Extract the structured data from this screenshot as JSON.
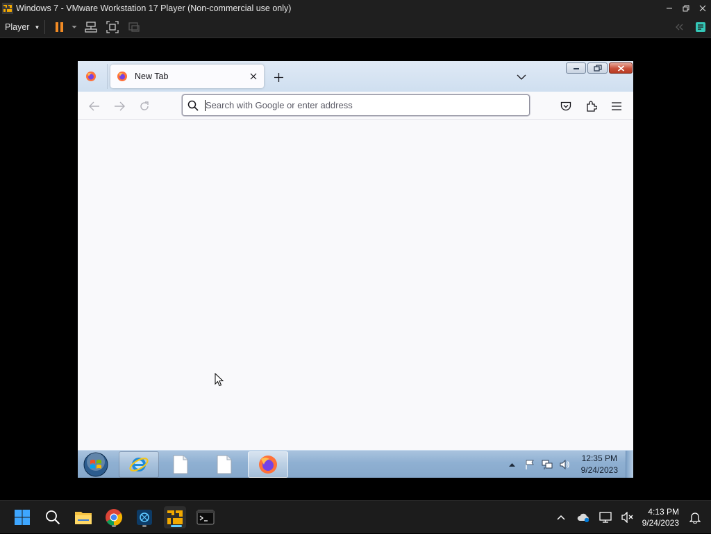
{
  "vmware": {
    "window_title": "Windows 7 - VMware Workstation 17 Player (Non-commercial use only)",
    "player_menu_label": "Player"
  },
  "firefox": {
    "tab_title": "New Tab",
    "url_placeholder": "Search with Google or enter address"
  },
  "win7_taskbar": {
    "time": "12:35 PM",
    "date": "9/24/2023"
  },
  "host_taskbar": {
    "time": "4:13 PM",
    "date": "9/24/2023"
  },
  "colors": {
    "firefox_orange": "#ff7139",
    "firefox_purple": "#7542e5",
    "vmware_accent": "#f2a900",
    "host_accent": "#60cdff"
  }
}
